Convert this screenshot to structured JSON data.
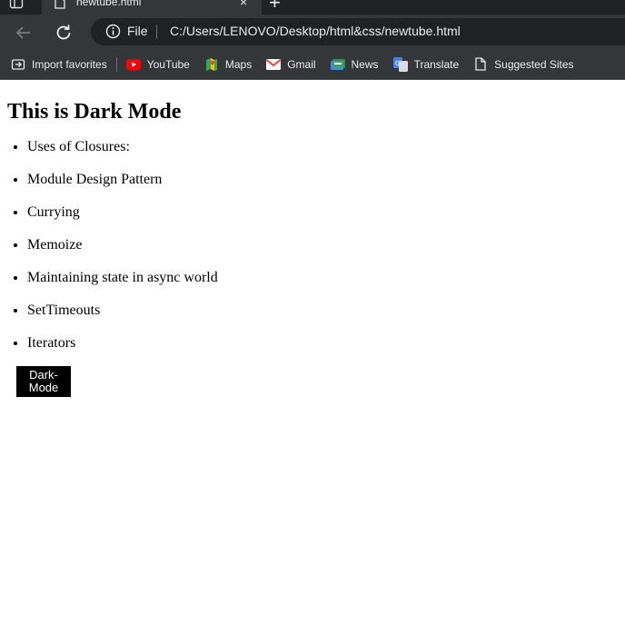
{
  "browser": {
    "tab": {
      "title": "newtube.html",
      "close": "×"
    },
    "new_tab": "+",
    "omnibox": {
      "scheme_label": "File",
      "url": "C:/Users/LENOVO/Desktop/html&css/newtube.html"
    },
    "bookmarks": [
      {
        "label": "Import favorites",
        "icon": "import-icon"
      },
      {
        "label": "YouTube",
        "icon": "youtube-icon",
        "color": "#ff0000"
      },
      {
        "label": "Maps",
        "icon": "maps-icon"
      },
      {
        "label": "Gmail",
        "icon": "gmail-icon",
        "color": "#ea4335"
      },
      {
        "label": "News",
        "icon": "news-icon"
      },
      {
        "label": "Translate",
        "icon": "translate-icon",
        "color": "#4285f4"
      },
      {
        "label": "Suggested Sites",
        "icon": "page-icon"
      }
    ]
  },
  "page": {
    "heading": "This is Dark Mode",
    "items": [
      "Uses of Closures:",
      "Module Design Pattern",
      "Currying",
      "Memoize",
      "Maintaining state in async world",
      "SetTimeouts",
      "Iterators"
    ],
    "button_label": "Dark-Mode"
  }
}
